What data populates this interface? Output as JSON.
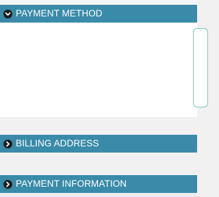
{
  "sections": {
    "payment_method": {
      "title": "PAYMENT METHOD",
      "state": "expanded",
      "icon": "chevron-down-icon"
    },
    "billing_address": {
      "title": "BILLING ADDRESS",
      "state": "collapsed",
      "icon": "chevron-right-icon"
    },
    "payment_information": {
      "title": "PAYMENT INFORMATION",
      "state": "collapsed",
      "icon": "chevron-right-icon"
    }
  },
  "colors": {
    "header_bg": "#3a8ba9",
    "header_text": "#ffffff",
    "icon_bg": "#1d1f21",
    "card_border": "#7fc3b8",
    "page_bg": "#f1f1f1"
  }
}
